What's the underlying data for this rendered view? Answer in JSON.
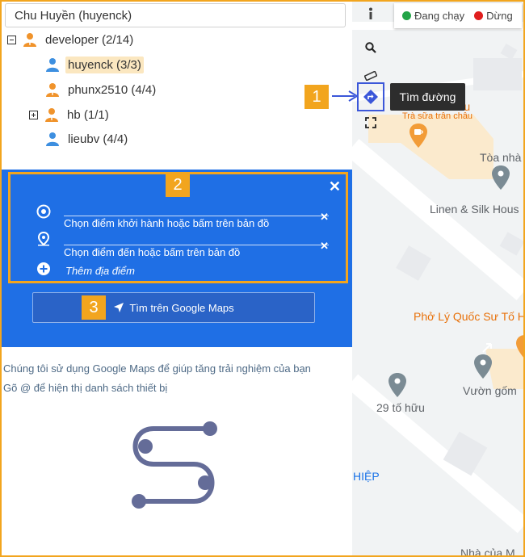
{
  "user_select": {
    "value": "Chu Huyền (huyenck)"
  },
  "tree": {
    "developer": "developer (2/14)",
    "huyenck": "huyenck (3/3)",
    "phunx2510": "phunx2510 (4/4)",
    "hb": "hb (1/1)",
    "lieubv": "lieubv (4/4)"
  },
  "route": {
    "origin_placeholder": "Chọn điểm khởi hành hoặc bấm trên bản đồ",
    "destination_placeholder": "Chọn điểm đến hoặc bấm trên bản đồ",
    "add_stop": "Thêm địa điểm",
    "search_button": "Tìm trên Google Maps",
    "close": "✕",
    "clear": "✕"
  },
  "notes": {
    "line1": "Chúng tôi sử dụng Google Maps để giúp tăng trải nghiệm của bạn",
    "line2": "Gõ @ để hiện thị danh sách thiết bị"
  },
  "badges": {
    "one": "1",
    "two": "2",
    "three": "3"
  },
  "map": {
    "legend_running": "Đang chạy",
    "legend_stopped": "Dừng",
    "tooltip": "Tìm đường",
    "places": {
      "yotea": "YoTea Tô hữu",
      "yotea_sub": "Trà sữa trân châu",
      "toa_nha": "Tòa nhà",
      "linen": "Linen & Silk Hous",
      "pho": "Phở Lý Quốc Sư Tố H",
      "vuon_gom": "Vườn gốm",
      "to_huu_29": "29 tố hữu",
      "hiep": "HIỆP",
      "nha_cua": "Nhà của M"
    }
  },
  "colors": {
    "accent": "#1f6fe5",
    "badge": "#f2a51e",
    "running": "#22a447",
    "stopped": "#e01e1e"
  }
}
